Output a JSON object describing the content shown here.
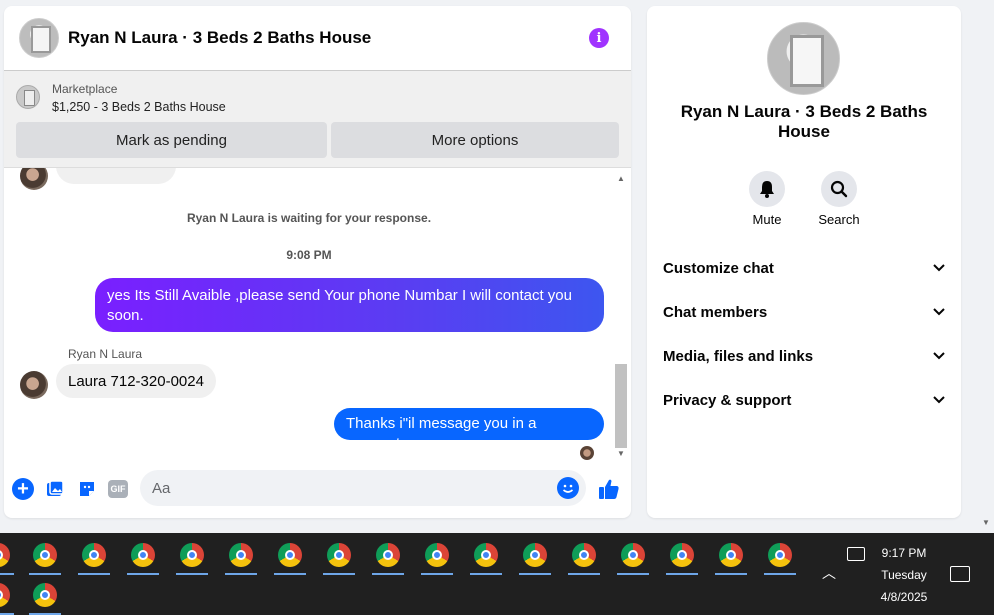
{
  "chat": {
    "title": "Ryan N Laura · 3 Beds 2 Baths House",
    "marketplace_label": "Marketplace",
    "marketplace_item": "$1,250 - 3 Beds 2 Baths House",
    "btn_pending": "Mark as pending",
    "btn_more": "More options",
    "waiting_text": "Ryan N Laura is waiting for your response.",
    "time": "9:08 PM",
    "messages": [
      {
        "from": "me",
        "text": "yes Its Still Avaible ,please send Your phone Numbar I will contact you soon."
      },
      {
        "from": "Ryan N Laura",
        "text": "Laura 712-320-0024"
      },
      {
        "from": "me",
        "text": "Thanks i\"il message you in a moment"
      }
    ],
    "sender_name": "Ryan N Laura",
    "composer_placeholder": "Aa",
    "gif_label": "GIF",
    "info_icon": "i"
  },
  "side": {
    "title": "Ryan N Laura · 3 Beds 2 Baths House",
    "actions": [
      {
        "label": "Mute",
        "icon": "bell-icon"
      },
      {
        "label": "Search",
        "icon": "search-icon"
      }
    ],
    "rows": [
      {
        "label": "Customize chat"
      },
      {
        "label": "Chat members"
      },
      {
        "label": "Media, files and links"
      },
      {
        "label": "Privacy & support"
      }
    ]
  },
  "taskbar": {
    "time": "9:17 PM",
    "day": "Tuesday",
    "date": "4/8/2025"
  },
  "colors": {
    "accent_blue": "#0866ff",
    "purple": "#7a1fff"
  }
}
